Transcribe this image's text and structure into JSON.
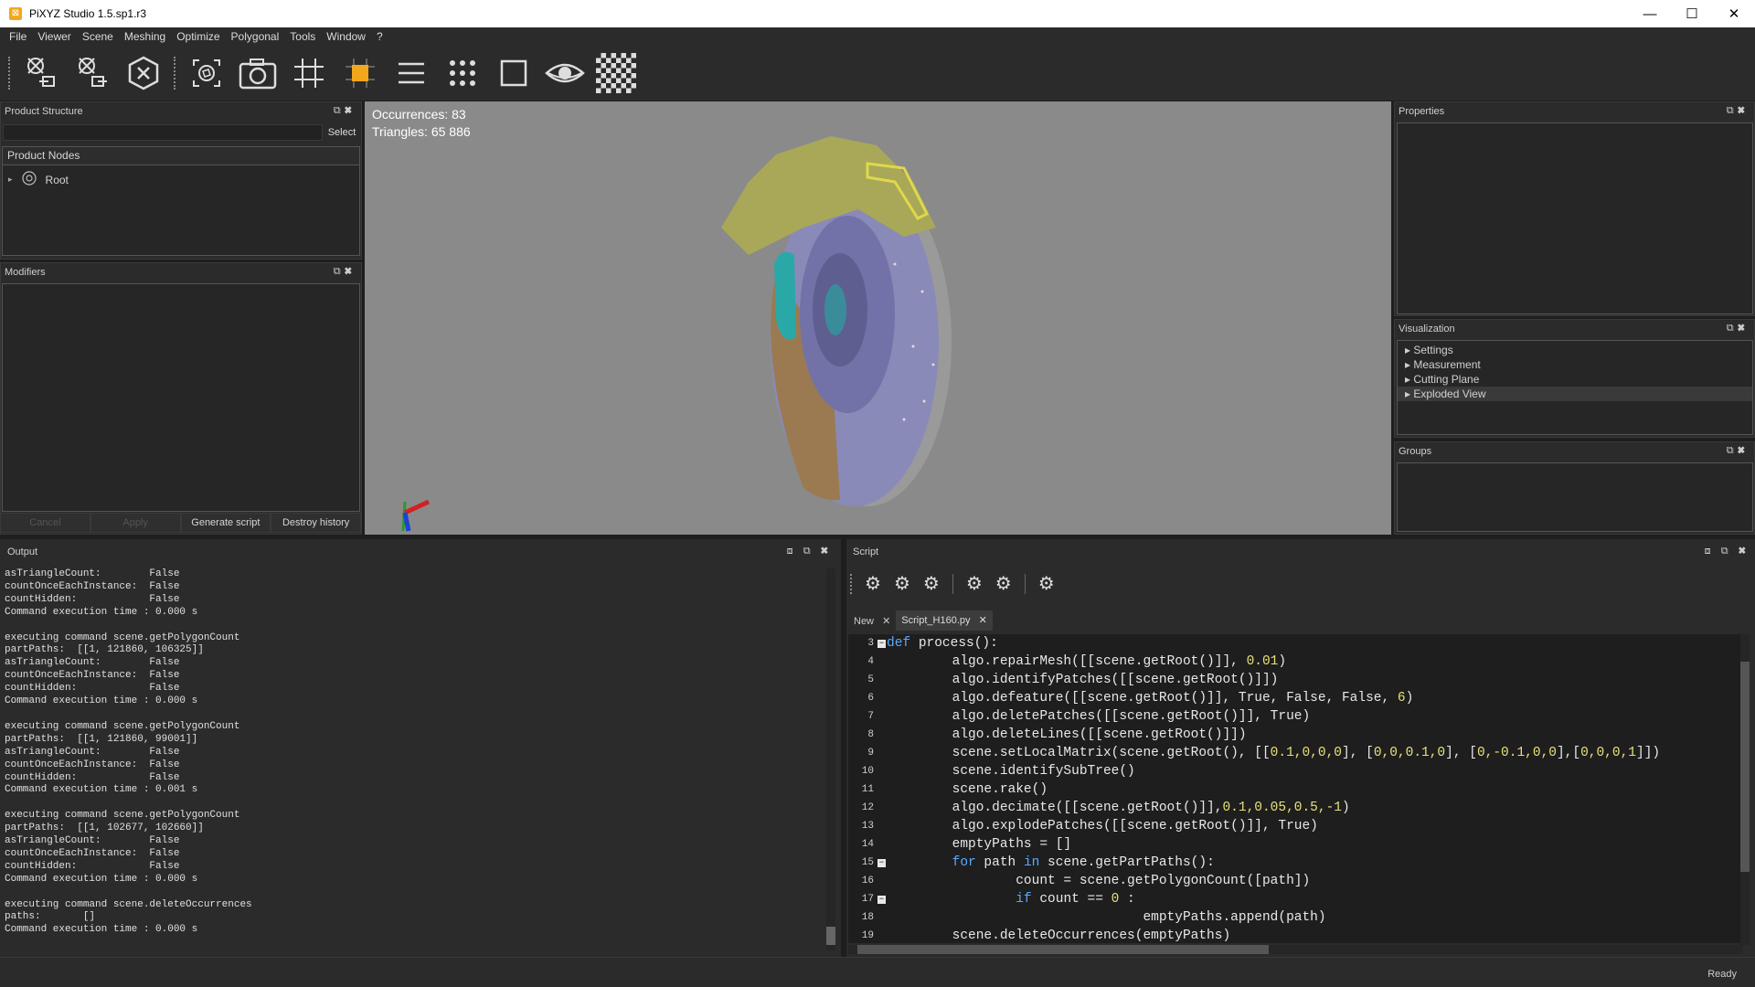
{
  "window": {
    "title": "PiXYZ Studio 1.5.sp1.r3"
  },
  "menu": [
    "File",
    "Viewer",
    "Scene",
    "Meshing",
    "Optimize",
    "Polygonal",
    "Tools",
    "Window",
    "?"
  ],
  "product_structure": {
    "title": "Product Structure",
    "select_label": "Select",
    "nodes_header": "Product Nodes",
    "root_label": "Root"
  },
  "modifiers": {
    "title": "Modifiers",
    "cancel": "Cancel",
    "apply": "Apply",
    "generate_script": "Generate script",
    "destroy_history": "Destroy history"
  },
  "viewport": {
    "occurrences": "Occurrences: 83",
    "triangles": "Triangles: 65 886"
  },
  "properties": {
    "title": "Properties"
  },
  "visualization": {
    "title": "Visualization",
    "items": [
      "Settings",
      "Measurement",
      "Cutting Plane",
      "Exploded View"
    ]
  },
  "groups": {
    "title": "Groups"
  },
  "output": {
    "title": "Output",
    "lines": [
      "asTriangleCount:        False",
      "countOnceEachInstance:  False",
      "countHidden:            False",
      "Command execution time : 0.000 s",
      "",
      "executing command scene.getPolygonCount",
      "partPaths:  [[1, 121860, 106325]]",
      "asTriangleCount:        False",
      "countOnceEachInstance:  False",
      "countHidden:            False",
      "Command execution time : 0.000 s",
      "",
      "executing command scene.getPolygonCount",
      "partPaths:  [[1, 121860, 99001]]",
      "asTriangleCount:        False",
      "countOnceEachInstance:  False",
      "countHidden:            False",
      "Command execution time : 0.001 s",
      "",
      "executing command scene.getPolygonCount",
      "partPaths:  [[1, 102677, 102660]]",
      "asTriangleCount:        False",
      "countOnceEachInstance:  False",
      "countHidden:            False",
      "Command execution time : 0.000 s",
      "",
      "executing command scene.deleteOccurrences",
      "paths:       []",
      "Command execution time : 0.000 s"
    ]
  },
  "script": {
    "title": "Script",
    "tabs": [
      "New",
      "Script_H160.py"
    ],
    "line_numbers": [
      "3",
      "4",
      "5",
      "6",
      "7",
      "8",
      "9",
      "10",
      "11",
      "12",
      "13",
      "14",
      "15",
      "16",
      "17",
      "18",
      "19"
    ],
    "code": {
      "l3": "process():",
      "l3kw": "def",
      "l4a": "        algo.repairMesh([[scene.getRoot()]], ",
      "l4n": "0.01",
      "l4b": ")",
      "l5": "        algo.identifyPatches([[scene.getRoot()]])",
      "l6a": "        algo.defeature([[scene.getRoot()]], True, False, False, ",
      "l6n": "6",
      "l6b": ")",
      "l7": "        algo.deletePatches([[scene.getRoot()]], True)",
      "l8": "        algo.deleteLines([[scene.getRoot()]])",
      "l9a": "        scene.setLocalMatrix(scene.getRoot(), [[",
      "l9n": "0.1,0,0,0",
      "l9b": "], [",
      "l9n2": "0,0,0.1,0",
      "l9c": "], [",
      "l9n3": "0,-0.1,0,0",
      "l9d": "],[",
      "l9n4": "0,0,0,1",
      "l9e": "]])",
      "l10": "        scene.identifySubTree()",
      "l11": "        scene.rake()",
      "l12a": "        algo.decimate([[scene.getRoot()]],",
      "l12n": "0.1,0.05,0.5,-1",
      "l12b": ")",
      "l13": "        algo.explodePatches([[scene.getRoot()]], True)",
      "l14": "        emptyPaths = []",
      "l15kw1": "for",
      "l15a": " path ",
      "l15kw2": "in",
      "l15b": " scene.getPartPaths():",
      "l16": "                count = scene.getPolygonCount([path])",
      "l17kw": "if",
      "l17a": " count == ",
      "l17n": "0",
      "l17b": " :",
      "l18": "                                emptyPaths.append(path)",
      "l19": "        scene.deleteOccurrences(emptyPaths)"
    }
  },
  "status": {
    "text": "Ready"
  },
  "colors": {
    "accent": "#f2a81d",
    "keyword": "#5aa9ff",
    "number": "#e8e07a"
  }
}
